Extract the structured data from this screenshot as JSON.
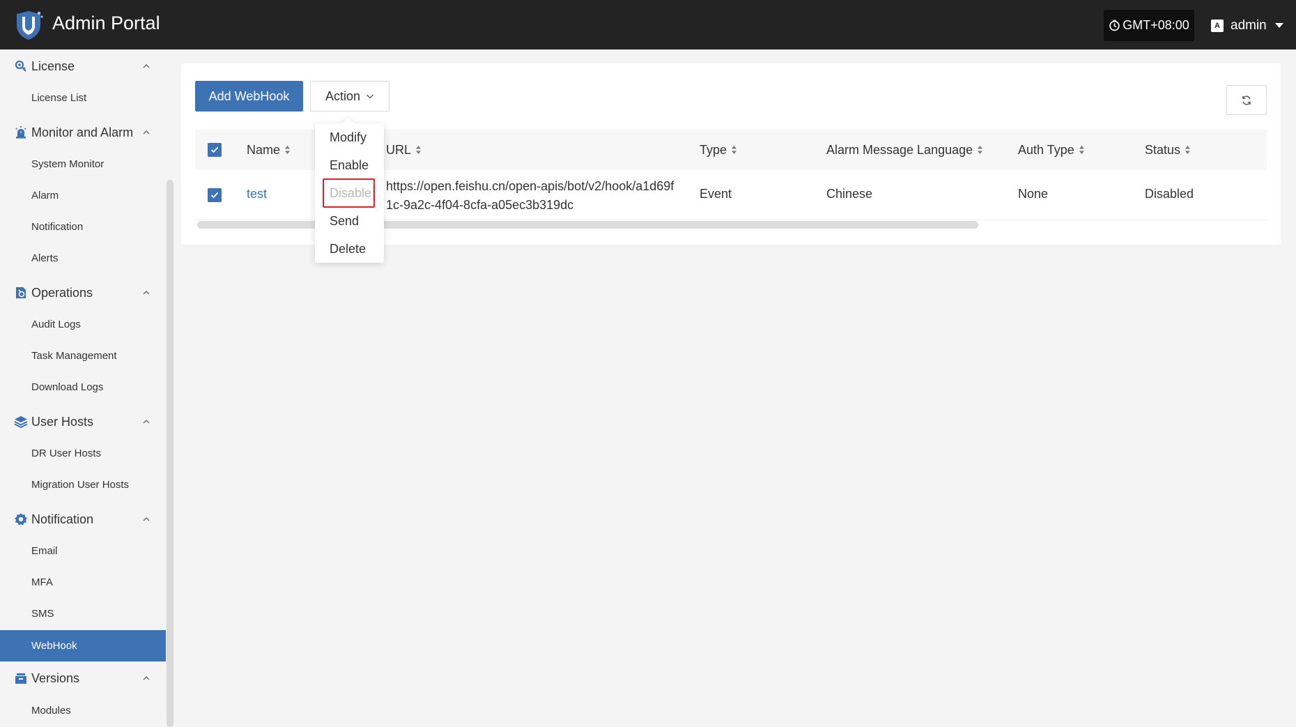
{
  "header": {
    "title": "Admin Portal",
    "timezone": "GMT+08:00",
    "lang_icon_text": "A",
    "user": "admin"
  },
  "sidebar": {
    "groups": [
      {
        "label": "License",
        "icon": "key-gear-icon",
        "items": [
          "License List"
        ]
      },
      {
        "label": "Monitor and Alarm",
        "icon": "alarm-light-icon",
        "items": [
          "System Monitor",
          "Alarm",
          "Notification",
          "Alerts"
        ]
      },
      {
        "label": "Operations",
        "icon": "operations-icon",
        "items": [
          "Audit Logs",
          "Task Management",
          "Download Logs"
        ]
      },
      {
        "label": "User Hosts",
        "icon": "layers-icon",
        "items": [
          "DR User Hosts",
          "Migration User Hosts"
        ]
      },
      {
        "label": "Notification",
        "icon": "gear-icon",
        "items": [
          "Email",
          "MFA",
          "SMS",
          "WebHook"
        ]
      },
      {
        "label": "Versions",
        "icon": "box-icon",
        "items": [
          "Modules"
        ]
      }
    ],
    "active_item": "WebHook"
  },
  "toolbar": {
    "add_label": "Add WebHook",
    "action_label": "Action"
  },
  "table": {
    "columns": [
      "Name",
      "URL",
      "Type",
      "Alarm Message Language",
      "Auth Type",
      "Status"
    ],
    "rows": [
      {
        "name": "test",
        "url_line1": "https://open.feishu.cn/open-apis/bot/v2/hook/a1d69f",
        "url_line2": "1c-9a2c-4f04-8cfa-a05ec3b319dc",
        "type": "Event",
        "language": "Chinese",
        "auth_type": "None",
        "status": "Disabled",
        "checked": true
      }
    ]
  },
  "action_menu": {
    "items": [
      "Modify",
      "Enable",
      "Disable",
      "Send",
      "Delete"
    ],
    "disabled": [
      "Disable"
    ]
  },
  "colors": {
    "primary": "#3d72b4",
    "header_bg": "#232323",
    "highlight": "#e02020"
  }
}
